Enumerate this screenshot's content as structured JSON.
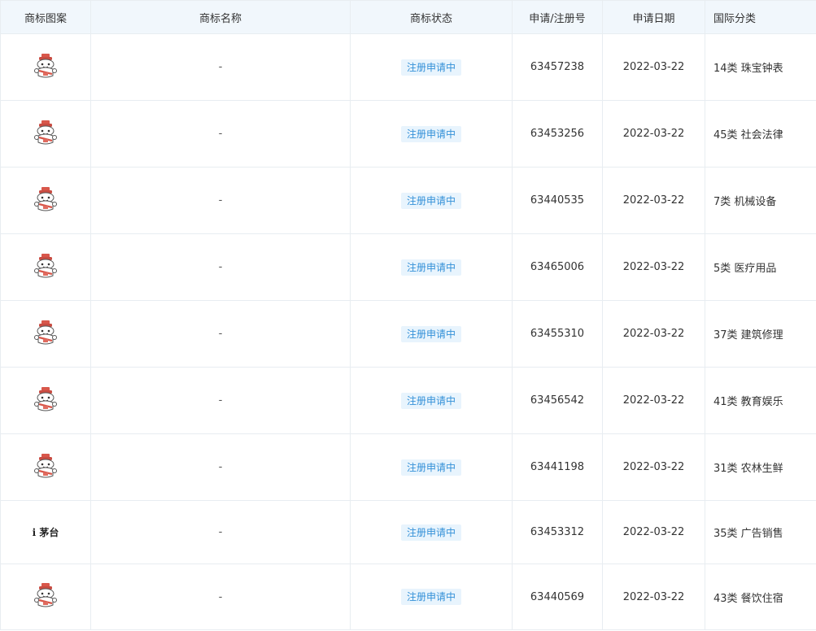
{
  "table": {
    "headers": {
      "pattern": "商标图案",
      "name": "商标名称",
      "status": "商标状态",
      "regno": "申请/注册号",
      "date": "申请日期",
      "class": "国际分类"
    },
    "rows": [
      {
        "logo": "mascot-logo-icon",
        "name": "-",
        "status": "注册申请中",
        "regno": "63457238",
        "date": "2022-03-22",
        "class": "14类 珠宝钟表"
      },
      {
        "logo": "mascot-logo-icon",
        "name": "-",
        "status": "注册申请中",
        "regno": "63453256",
        "date": "2022-03-22",
        "class": "45类 社会法律"
      },
      {
        "logo": "mascot-logo-icon",
        "name": "-",
        "status": "注册申请中",
        "regno": "63440535",
        "date": "2022-03-22",
        "class": "7类 机械设备"
      },
      {
        "logo": "mascot-logo-icon",
        "name": "-",
        "status": "注册申请中",
        "regno": "63465006",
        "date": "2022-03-22",
        "class": "5类 医疗用品"
      },
      {
        "logo": "mascot-logo-icon",
        "name": "-",
        "status": "注册申请中",
        "regno": "63455310",
        "date": "2022-03-22",
        "class": "37类 建筑修理"
      },
      {
        "logo": "mascot-logo-icon",
        "name": "-",
        "status": "注册申请中",
        "regno": "63456542",
        "date": "2022-03-22",
        "class": "41类 教育娱乐"
      },
      {
        "logo": "mascot-logo-icon",
        "name": "-",
        "status": "注册申请中",
        "regno": "63441198",
        "date": "2022-03-22",
        "class": "31类 农林生鲜"
      },
      {
        "logo_text": "i 茅台",
        "name": "-",
        "status": "注册申请中",
        "regno": "63453312",
        "date": "2022-03-22",
        "class": "35类 广告销售"
      },
      {
        "logo": "mascot-logo-icon",
        "name": "-",
        "status": "注册申请中",
        "regno": "63440569",
        "date": "2022-03-22",
        "class": "43类 餐饮住宿"
      }
    ]
  },
  "colors": {
    "header_bg": "#f1f7fc",
    "border": "#e8edf1",
    "badge_bg": "#e8f4fd",
    "badge_text": "#3390d8",
    "logo_red": "#d8574b"
  }
}
